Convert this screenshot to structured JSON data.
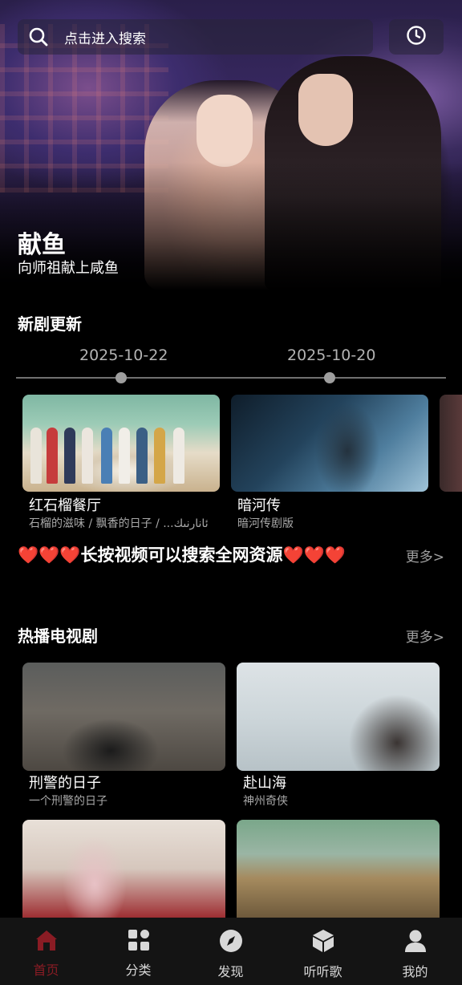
{
  "search": {
    "placeholder": "点击进入搜索",
    "icon": "search-icon"
  },
  "history": {
    "icon": "clock-icon"
  },
  "hero": {
    "title": "献鱼",
    "subtitle": "向师祖献上咸鱼"
  },
  "new_updates": {
    "title": "新剧更新",
    "dates": [
      "2025-10-22",
      "2025-10-20"
    ],
    "items": [
      {
        "title": "红石榴餐厅",
        "subtitle": "石榴的滋味 / 飘香的日子 / ...ئانارنىك"
      },
      {
        "title": "暗河传",
        "subtitle": "暗河传剧版"
      }
    ]
  },
  "banner": {
    "hearts": "❤️❤️❤️",
    "text": "长按视频可以搜索全网资源",
    "more": "更多>"
  },
  "hot_tv": {
    "title": "热播电视剧",
    "more": "更多>",
    "items": [
      {
        "title": "刑警的日子",
        "subtitle": "一个刑警的日子"
      },
      {
        "title": "赴山海",
        "subtitle": "神州奇侠"
      }
    ]
  },
  "tabs": [
    {
      "label": "首页",
      "icon": "home-icon",
      "active": true
    },
    {
      "label": "分类",
      "icon": "grid-icon",
      "active": false
    },
    {
      "label": "发现",
      "icon": "compass-icon",
      "active": false
    },
    {
      "label": "听听歌",
      "icon": "cube-icon",
      "active": false
    },
    {
      "label": "我的",
      "icon": "user-icon",
      "active": false
    }
  ],
  "colors": {
    "accent": "#8a1c24",
    "heart": "#ff2a2a",
    "muted": "#a0a0a0"
  }
}
